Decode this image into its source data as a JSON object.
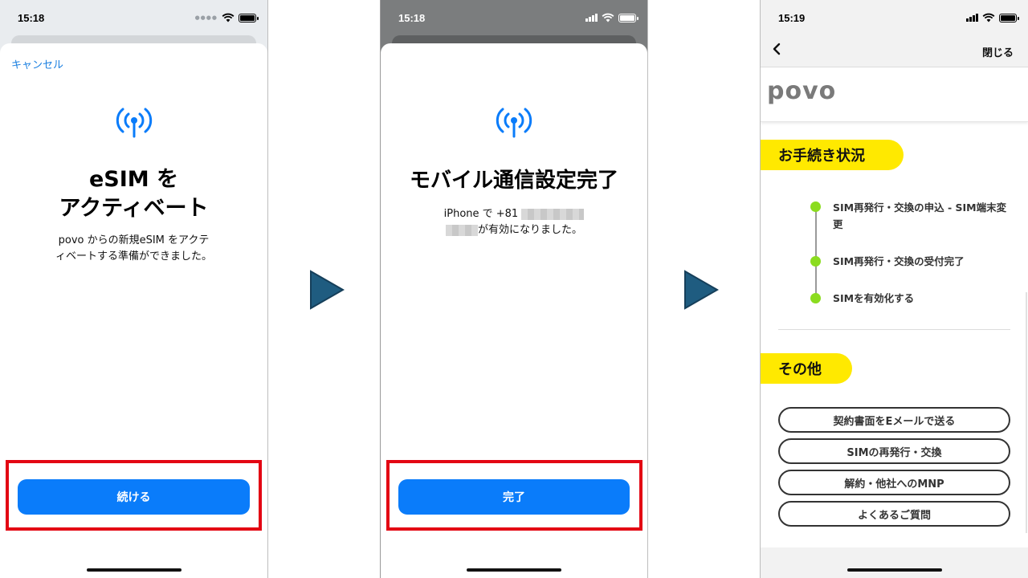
{
  "screens": [
    {
      "time": "15:18",
      "cancel_label": "キャンセル",
      "title_line1": "eSIM をアクティベート",
      "title_line2": "",
      "subtitle_line1": "povo からの新規eSIM をアクテ",
      "subtitle_line2": "ィベートする準備ができました。",
      "button_label": "続ける"
    },
    {
      "time": "15:18",
      "title": "モバイル通信設定完了",
      "subtitle_line1_prefix": "iPhone で +81",
      "subtitle_line2_suffix": "が有効になりました。",
      "button_label": "完了"
    },
    {
      "time": "15:19",
      "close_label": "閉じる",
      "logo_text": "povo",
      "status_heading": "お手続き状況",
      "timeline": [
        "SIM再発行・交換の申込 - SIM端末変更",
        "SIM再発行・交換の受付完了",
        "SIMを有効化する"
      ],
      "other_heading": "その他",
      "buttons": [
        "契約書面をEメールで送る",
        "SIMの再発行・交換",
        "解約・他社へのMNP",
        "よくあるご質問"
      ]
    }
  ],
  "colors": {
    "primary_button": "#0a7cfa",
    "highlight_box": "#e30613",
    "accent_yellow": "#ffe900",
    "timeline_dot": "#8bdc1f",
    "arrow": "#1f5c80",
    "link": "#1a7fe0"
  },
  "icons": [
    "antenna-icon",
    "wifi-icon",
    "battery-icon",
    "signal-icon",
    "chevron-left-icon",
    "next-arrow-icon"
  ]
}
